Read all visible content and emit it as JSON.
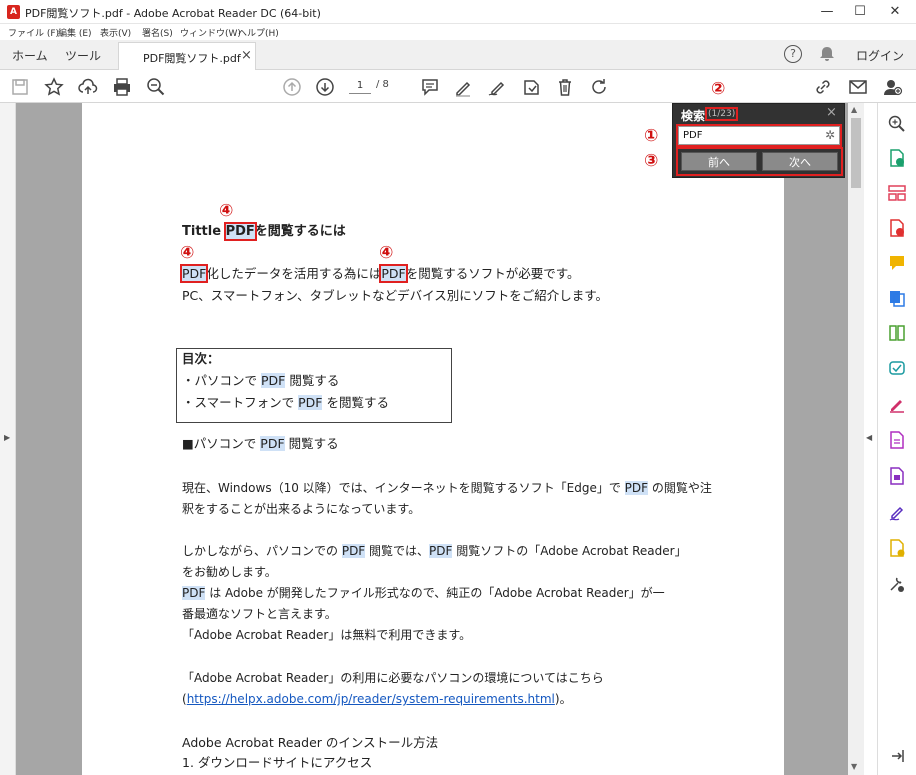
{
  "window": {
    "title": "PDF閲覧ソフト.pdf - Adobe Acrobat Reader DC (64-bit)",
    "app_icon": "pdf-app-icon",
    "minimize": "—",
    "maximize": "☐",
    "close": "✕"
  },
  "menu": [
    "ファイル (F)",
    "編集 (E)",
    "表示(V)",
    "署名(S)",
    "ウィンドウ(W)",
    "ヘルプ(H)"
  ],
  "tabs": {
    "home": "ホーム",
    "tools": "ツール",
    "document": "PDF閲覧ソフト.pdf",
    "doc_close": "×",
    "login": "ログイン"
  },
  "toolbar": {
    "page_current": "1",
    "page_total": "/ 8"
  },
  "find": {
    "title": "検索",
    "count": "(1/23)",
    "query": "PDF",
    "prev_label": "前へ",
    "next_label": "次へ",
    "close": "×"
  },
  "annotations": {
    "one": "①",
    "two": "②",
    "three": "③",
    "four": "④"
  },
  "doc": {
    "title_pre": "Tittle ",
    "title_hl": "PDF",
    "title_post": "を閲覧するには",
    "l1_hl1": "PDF",
    "l1_mid": "化したデータを活用する為には",
    "l1_hl2": "PDF",
    "l1_post": "を閲覧するソフトが必要です。",
    "l2": "PC、スマートフォン、タブレットなどデバイス別にソフトをご紹介します。",
    "toc_head": "目次：",
    "toc1_pre": "・パソコンで ",
    "toc1_hl": "PDF",
    "toc1_post": " 閲覧する",
    "toc2_pre": "・スマートフォンで ",
    "toc2_hl": "PDF",
    "toc2_post": " を閲覧する",
    "sec1_pre": "■パソコンで ",
    "sec1_hl": "PDF",
    "sec1_post": " 閲覧する",
    "p1a_pre": "現在、Windows（10 以降）では、インターネットを閲覧するソフト「Edge」で ",
    "p1a_hl": "PDF",
    "p1a_post": " の閲覧や注",
    "p1b": "釈をすることが出来るようになっています。",
    "p2a_pre": "しかしながら、パソコンでの ",
    "p2a_hl1": "PDF",
    "p2a_mid": " 閲覧では、",
    "p2a_hl2": "PDF",
    "p2a_post": " 閲覧ソフトの「Adobe Acrobat Reader」",
    "p2b": "をお勧めします。",
    "p2c_hl": "PDF",
    "p2c_post": " は Adobe が開発したファイル形式なので、純正の「Adobe Acrobat Reader」が一",
    "p2d": "番最適なソフトと言えます。",
    "p2e": "「Adobe Acrobat Reader」は無料で利用できます。",
    "p3a": "「Adobe Acrobat Reader」の利用に必要なパソコンの環境についてはこちら",
    "p3b_pre": "(",
    "p3b_link": "https://helpx.adobe.com/jp/reader/system-requirements.html",
    "p3b_post": ")。",
    "h2": "Adobe Acrobat Reader のインストール方法",
    "h3": "1.  ダウンロードサイトにアクセス"
  }
}
